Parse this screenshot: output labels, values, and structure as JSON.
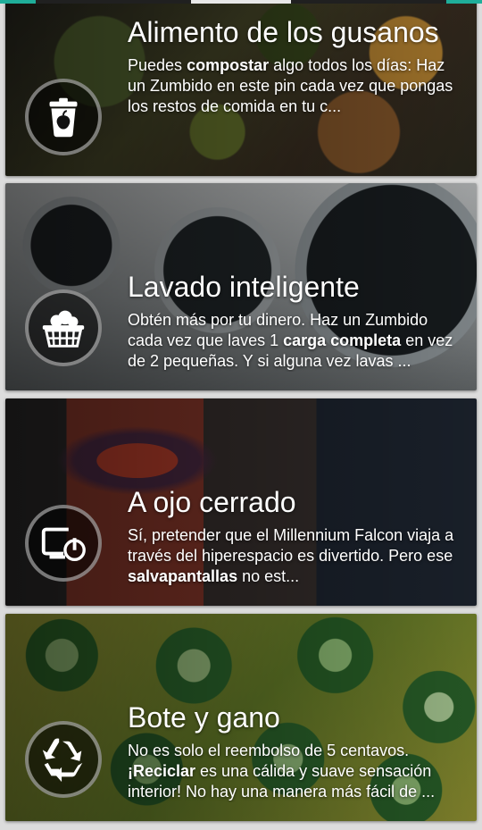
{
  "cards": [
    {
      "title": "Alimento de los gusanos",
      "desc_before": "Puedes ",
      "desc_bold": "compostar",
      "desc_after": " algo todos los días: Haz un Zumbido en este pin cada vez que pongas los restos de comida en tu c...",
      "icon": "compost-bin-icon"
    },
    {
      "title": "Lavado inteligente",
      "desc_before": "Obtén más por tu dinero. Haz un Zumbido cada vez que laves 1 ",
      "desc_bold": "carga completa",
      "desc_after": " en vez de 2 pequeñas. Y si alguna vez lavas ...",
      "icon": "laundry-basket-icon"
    },
    {
      "title": "A ojo cerrado",
      "desc_before": "Sí, pretender que el Millennium Falcon viaja a través del hiperespacio es divertido. Pero ese ",
      "desc_bold": "salvapantallas",
      "desc_after": " no est...",
      "icon": "monitor-power-icon"
    },
    {
      "title": "Bote y gano",
      "desc_before": "No es solo el reembolso de 5 centavos. ",
      "desc_bold": "¡Reciclar",
      "desc_after": " es una cálida y suave sensación interior! No hay una manera más fácil de ...",
      "icon": "recycle-icon"
    }
  ],
  "colors": {
    "accent": "#1fae9a",
    "text": "#ffffff"
  }
}
